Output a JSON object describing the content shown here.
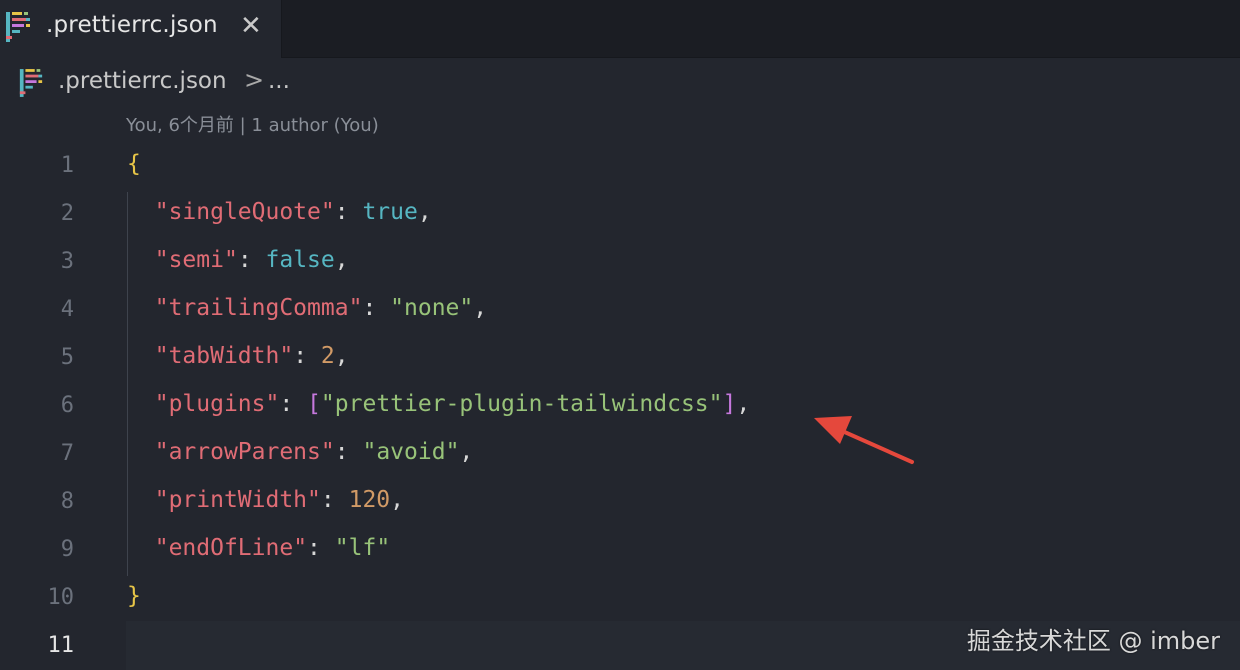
{
  "tab": {
    "label": ".prettierrc.json",
    "close_glyph": "✕",
    "icon": "prettier-file-icon"
  },
  "breadcrumb": {
    "file": ".prettierrc.json",
    "separator": ">",
    "more": "..."
  },
  "blame": {
    "text": "You, 6个月前 | 1 author (You)"
  },
  "editor": {
    "active_line": 11,
    "lines": [
      {
        "num": "1"
      },
      {
        "num": "2",
        "key": "singleQuote",
        "value": "true"
      },
      {
        "num": "3",
        "key": "semi",
        "value": "false"
      },
      {
        "num": "4",
        "key": "trailingComma",
        "value": "none"
      },
      {
        "num": "5",
        "key": "tabWidth",
        "value": "2"
      },
      {
        "num": "6",
        "key": "plugins",
        "value": "prettier-plugin-tailwindcss"
      },
      {
        "num": "7",
        "key": "arrowParens",
        "value": "avoid"
      },
      {
        "num": "8",
        "key": "printWidth",
        "value": "120"
      },
      {
        "num": "9",
        "key": "endOfLine",
        "value": "lf"
      },
      {
        "num": "10"
      },
      {
        "num": "11"
      }
    ]
  },
  "colors": {
    "background": "#23262e",
    "tabbar": "#1b1d23",
    "key": "#e06c75",
    "string": "#98c379",
    "boolean": "#56b6c2",
    "number": "#d19a66",
    "brace": "#e7c547",
    "arrow": "#e5483c"
  },
  "watermark": {
    "text": "掘金技术社区 @ imber"
  }
}
